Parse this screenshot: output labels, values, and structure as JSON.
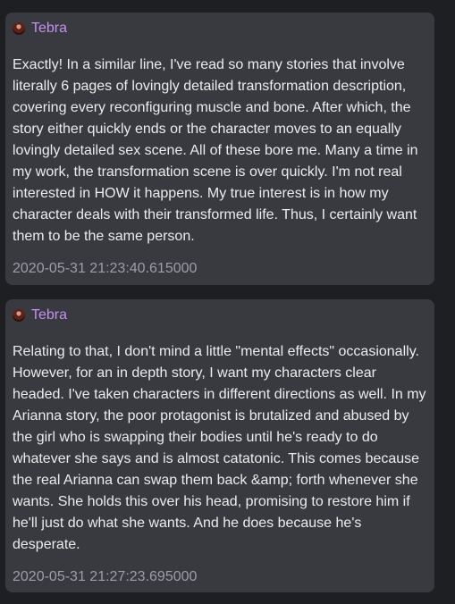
{
  "messages": [
    {
      "author": "Tebra",
      "avatar_icon": "user-avatar-icon",
      "content": "Exactly! In a similar line, I've read so many stories that involve literally 6 pages of lovingly detailed transformation description, covering every reconfiguring muscle and bone. After which, the story either quickly ends or the character moves to an equally lovingly detailed sex scene. All of these bore me. Many a time in my work, the transformation scene is over quickly. I'm not real interested in HOW it happens. My true interest is in how my character deals with their transformed life. Thus, I certainly want them to be the same person.",
      "timestamp": "2020-05-31 21:23:40.615000"
    },
    {
      "author": "Tebra",
      "avatar_icon": "user-avatar-icon",
      "content": "Relating to that, I don't mind a little \"mental effects\" occasionally. However, for an in depth story, I want my characters clear headed. I've taken characters in different directions as well. In my Arianna story, the poor protagonist is brutalized and abused by the girl who is swapping their bodies until he's ready to do whatever she says and is almost catatonic. This comes because the real Arianna can swap them back &amp; forth whenever she wants. She holds this over his head, promising to restore him if he'll just do what she wants. And he does because he's desperate.",
      "timestamp": "2020-05-31 21:27:23.695000"
    }
  ],
  "colors": {
    "background": "#1e1f22",
    "card": "#383a40",
    "author": "#c390f2",
    "text": "#ececec",
    "timestamp": "#9d9fa6"
  }
}
